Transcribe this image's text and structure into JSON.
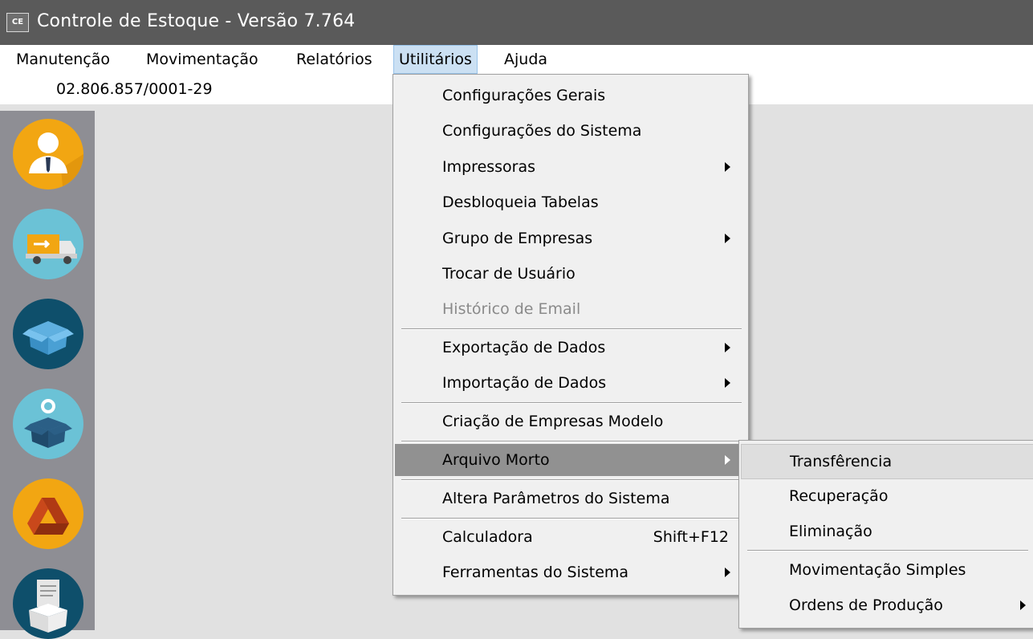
{
  "window": {
    "icon_text": "CE",
    "title": "Controle de Estoque - Versão 7.764"
  },
  "menubar": {
    "items": [
      {
        "label": "Manutenção"
      },
      {
        "label": "Movimentação"
      },
      {
        "label": "Relatórios"
      },
      {
        "label": "Utilitários"
      },
      {
        "label": "Ajuda"
      }
    ],
    "active": "Utilitários"
  },
  "infobar": {
    "cnpj": "02.806.857/0001-29"
  },
  "sidebar": {
    "buttons": [
      {
        "icon": "user-icon",
        "color": "#f2a612"
      },
      {
        "icon": "delivery-truck-icon",
        "color": "#6bc2d6"
      },
      {
        "icon": "box-icon",
        "color": "#0e4f6b"
      },
      {
        "icon": "box-settings-icon",
        "color": "#6bc2d6"
      },
      {
        "icon": "drive-icon",
        "color": "#f2a612"
      },
      {
        "icon": "document-box-icon",
        "color": "#0e4f6b"
      }
    ]
  },
  "utilitarios_menu": {
    "items": [
      {
        "label": "Configurações Gerais"
      },
      {
        "label": "Configurações do Sistema"
      },
      {
        "label": "Impressoras"
      },
      {
        "label": "Desbloqueia Tabelas"
      },
      {
        "label": "Grupo de Empresas"
      },
      {
        "label": "Trocar de Usuário"
      },
      {
        "label": "Histórico de Email"
      },
      {
        "label": "Exportação de Dados"
      },
      {
        "label": "Importação de Dados"
      },
      {
        "label": "Criação de Empresas Modelo"
      },
      {
        "label": "Arquivo Morto"
      },
      {
        "label": "Altera Parâmetros do Sistema"
      },
      {
        "label": "Calculadora",
        "shortcut": "Shift+F12"
      },
      {
        "label": "Ferramentas do Sistema"
      }
    ]
  },
  "arquivo_morto_submenu": {
    "items": [
      {
        "label": "Transfêrencia"
      },
      {
        "label": "Recuperação"
      },
      {
        "label": "Eliminação"
      },
      {
        "label": "Movimentação Simples"
      },
      {
        "label": "Ordens de Produção"
      }
    ]
  }
}
